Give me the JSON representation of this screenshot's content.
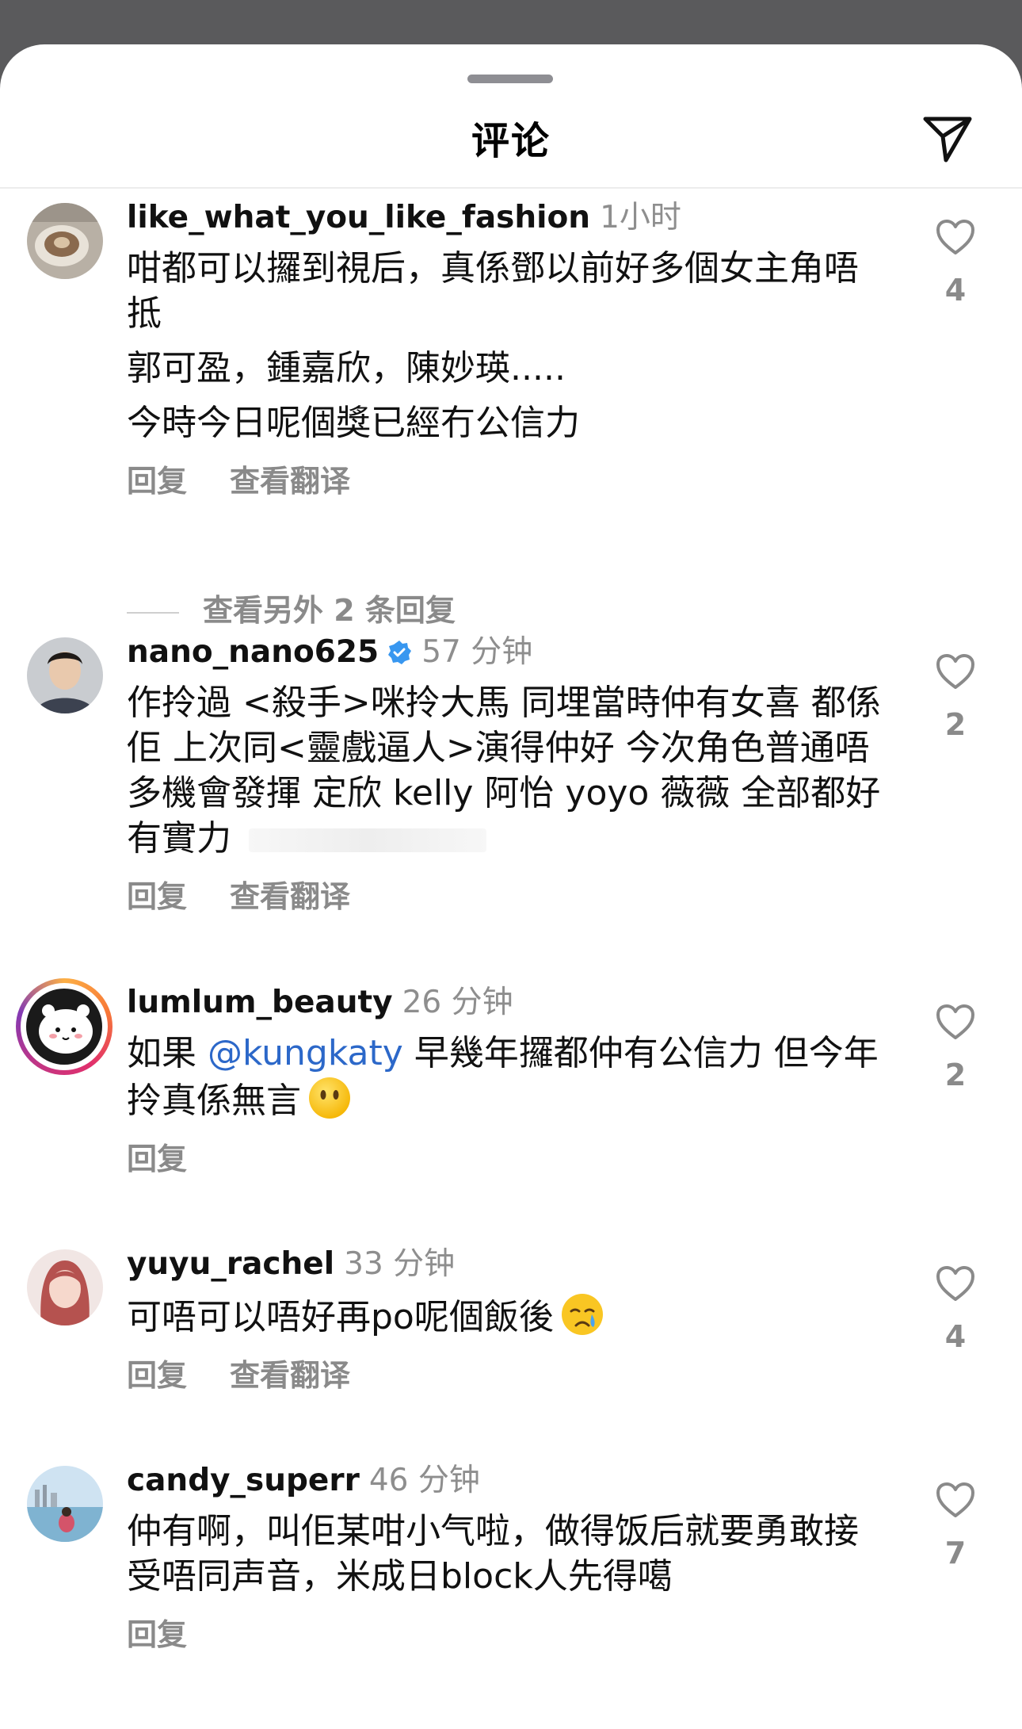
{
  "header": {
    "title": "评论"
  },
  "comments": [
    {
      "username": "like_what_you_like_fashion",
      "time": "1小时",
      "lines": [
        "咁都可以攞到視后，真係鄧以前好多個女主角唔抵",
        "郭可盈，鍾嘉欣，陳妙瑛.....",
        "今時今日呢個獎已經冇公信力"
      ],
      "reply_label": "回复",
      "translate_label": "查看翻译",
      "likes": "4"
    },
    {
      "username": "nano_nano625",
      "verified": true,
      "time": "57 分钟",
      "text": "作拎過 <殺手>咪拎大馬 同埋當時仲有女喜 都係佢 上次同<靈戲逼人>演得仲好 今次角色普通唔多機會發揮 定欣 kelly 阿怡 yoyo 薇薇 全部都好有實力",
      "reply_label": "回复",
      "translate_label": "查看翻译",
      "likes": "2"
    },
    {
      "username": "lumlum_beauty",
      "time": "26 分钟",
      "text_before": "如果 ",
      "mention": "@kungkaty",
      "text_after": " 早幾年攞都仲有公信力 但今年拎真係無言",
      "emoji": "no-mouth-face",
      "reply_label": "回复",
      "likes": "2"
    },
    {
      "username": "yuyu_rachel",
      "time": "33 分钟",
      "text": "可唔可以唔好再po呢個飯後",
      "emoji": "crying-face",
      "reply_label": "回复",
      "translate_label": "查看翻译",
      "likes": "4"
    },
    {
      "username": "candy_superr",
      "time": "46 分钟",
      "text": "仲有啊，叫佢某咁小气啦，做得饭后就要勇敢接受唔同声音，米成日block人先得噶",
      "reply_label": "回复",
      "likes": "7"
    }
  ],
  "more_replies": "查看另外 2 条回复",
  "colors": {
    "mention": "#2c68c9",
    "muted": "#8e8e8e",
    "verified": "#3897f0"
  }
}
